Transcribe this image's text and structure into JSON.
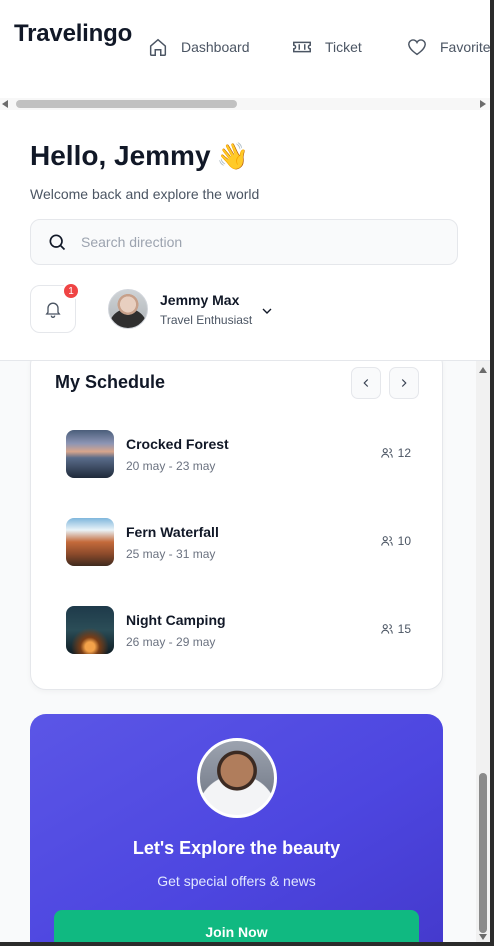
{
  "app": {
    "logo": "Travelingo"
  },
  "nav": {
    "items": [
      {
        "label": "Dashboard",
        "icon": "home-icon"
      },
      {
        "label": "Ticket",
        "icon": "ticket-icon"
      },
      {
        "label": "Favorite",
        "icon": "heart-icon"
      }
    ]
  },
  "header": {
    "greeting": "Hello, Jemmy",
    "wave_emoji": "👋",
    "subtitle": "Welcome back and explore the world",
    "search_placeholder": "Search direction",
    "notification_count": "1",
    "user": {
      "name": "Jemmy Max",
      "role": "Travel Enthusiast"
    }
  },
  "schedule": {
    "title": "My Schedule",
    "items": [
      {
        "title": "Crocked Forest",
        "dates": "20 may - 23 may",
        "count": "12"
      },
      {
        "title": "Fern Waterfall",
        "dates": "25 may - 31 may",
        "count": "10"
      },
      {
        "title": "Night Camping",
        "dates": "26 may - 29 may",
        "count": "15"
      }
    ]
  },
  "promo": {
    "title": "Let's Explore the beauty",
    "subtitle": "Get special offers & news",
    "button_label": "Join Now"
  },
  "colors": {
    "promo_gradient_start": "#5b56e6",
    "promo_gradient_end": "#4338ca",
    "join_button": "#10b981",
    "badge": "#ef4444"
  }
}
